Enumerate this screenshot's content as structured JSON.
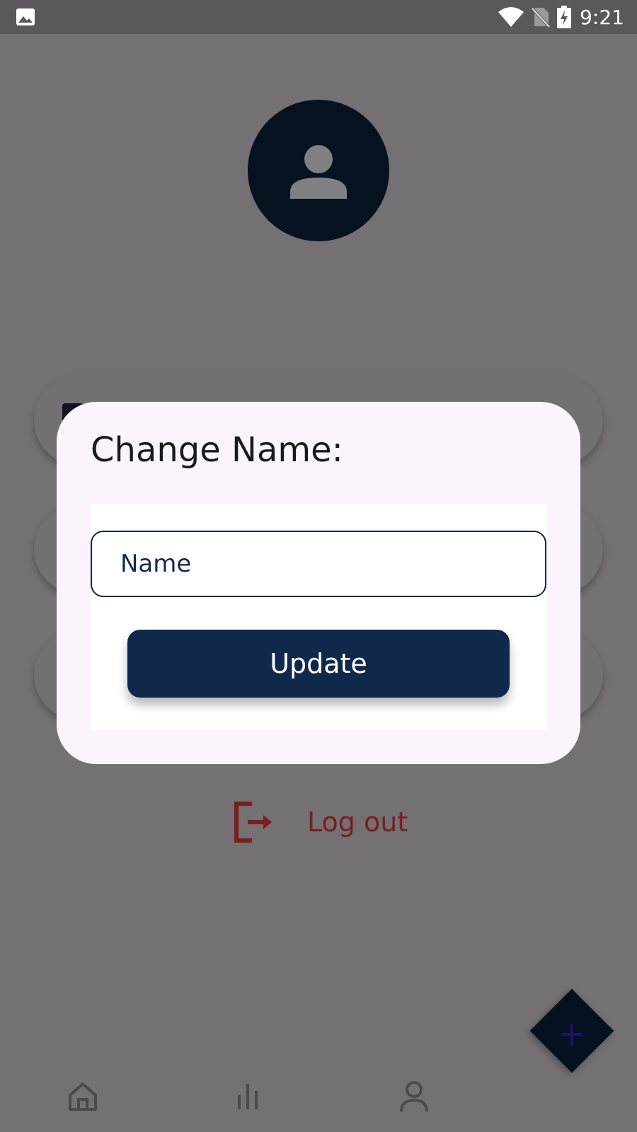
{
  "status_bar": {
    "time": "9:21",
    "icons": [
      "gallery-icon",
      "wifi-icon",
      "no-sim-icon",
      "battery-charging-icon"
    ]
  },
  "profile": {
    "avatar_icon": "person-icon"
  },
  "logout": {
    "label": "Log out",
    "icon": "logout-icon",
    "color": "#7a1f1f"
  },
  "dialog": {
    "title": "Change Name:",
    "name_input": {
      "value": "",
      "placeholder": "Name"
    },
    "update_label": "Update"
  },
  "fab": {
    "icon": "plus-icon"
  },
  "bottom_nav": {
    "items": [
      {
        "icon": "home-icon"
      },
      {
        "icon": "stats-icon"
      },
      {
        "icon": "profile-icon"
      }
    ]
  },
  "colors": {
    "primary": "#10294b",
    "scrim": "#747074",
    "dialog_bg": "#fcf4fc",
    "danger": "#7a1f1f"
  }
}
